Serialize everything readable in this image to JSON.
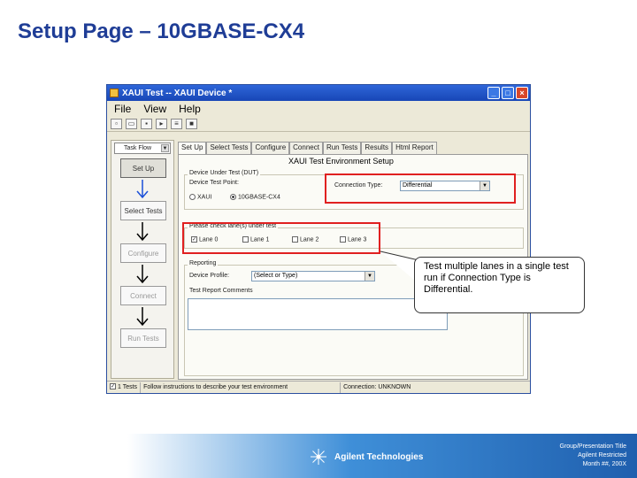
{
  "slide": {
    "title": "Setup Page – 10GBASE-CX4"
  },
  "window": {
    "title": "XAUI Test -- XAUI Device *",
    "menu": [
      "File",
      "View",
      "Help"
    ],
    "toolbar_icons": [
      "new-icon",
      "open-icon",
      "save-icon",
      "run-icon",
      "step-icon",
      "stop-icon"
    ]
  },
  "taskflow": {
    "header": "Task Flow",
    "buttons": [
      "Set Up",
      "Select Tests",
      "Configure",
      "Connect",
      "Run Tests"
    ]
  },
  "tabs": [
    "Set Up",
    "Select Tests",
    "Configure",
    "Connect",
    "Run Tests",
    "Results",
    "Html Report"
  ],
  "setup": {
    "title": "XAUI Test Environment Setup",
    "dut_group": "Device Under Test (DUT)",
    "test_point_label": "Device Test Point:",
    "test_points": [
      "XAUI",
      "10GBASE-CX4"
    ],
    "connection_type_label": "Connection Type:",
    "connection_type_value": "Differential",
    "lanes_label": "Please check lane(s) under test",
    "lanes": [
      "Lane 0",
      "Lane 1",
      "Lane 2",
      "Lane 3"
    ],
    "reporting_group": "Reporting",
    "device_profile_label": "Device Profile:",
    "device_profile_value": "(Select or Type)",
    "comments_label": "Test Report Comments"
  },
  "statusbar": {
    "tests": "1 Tests",
    "message": "Follow instructions to describe your test environment",
    "connection": "Connection: UNKNOWN"
  },
  "callout": {
    "text": "Test multiple lanes in a single test run if Connection Type is Differential."
  },
  "footer": {
    "brand": "Agilent Technologies",
    "info_line1": "Group/Presentation Title",
    "info_line2": "Agilent Restricted",
    "info_line3": "Month ##, 200X"
  },
  "colors": {
    "title": "#1f3d96",
    "highlight": "#e02020",
    "footer": "#1f5fae"
  }
}
